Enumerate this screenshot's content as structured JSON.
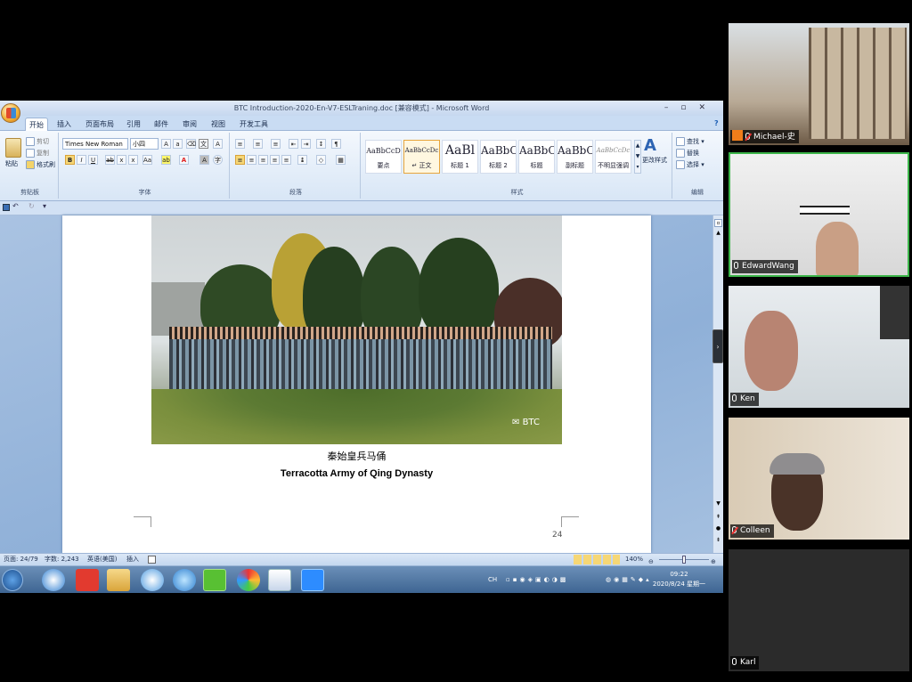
{
  "window": {
    "title": "BTC Introduction-2020-En-V7-ESLTraning.doc [兼容模式] - Microsoft Word",
    "controls": [
      "–",
      "▫",
      "✕"
    ]
  },
  "ribbon_tabs": [
    "开始",
    "插入",
    "页面布局",
    "引用",
    "邮件",
    "审阅",
    "视图",
    "开发工具"
  ],
  "active_tab": "开始",
  "clipboard": {
    "paste": "粘贴",
    "cut": "剪切",
    "copy": "复制",
    "format_painter": "格式刷",
    "label": "剪贴板"
  },
  "font": {
    "name": "Times New Roman",
    "size": "小四",
    "label": "字体"
  },
  "paragraph": {
    "label": "段落"
  },
  "styles": {
    "label": "样式",
    "items": [
      {
        "sample": "AaBbCcD",
        "name": "要点"
      },
      {
        "sample": "AaBbCcDc",
        "name": "↵ 正文"
      },
      {
        "sample": "AaBl",
        "name": "标题 1"
      },
      {
        "sample": "AaBbC",
        "name": "标题 2"
      },
      {
        "sample": "AaBbC",
        "name": "标题"
      },
      {
        "sample": "AaBbC",
        "name": "副标题"
      },
      {
        "sample": "AaBbCcDc",
        "name": "不明显强调"
      }
    ],
    "change_styles": "更改样式"
  },
  "editing": {
    "find": "查找 ▾",
    "replace": "替换",
    "select": "选择 ▾",
    "label": "编辑"
  },
  "document": {
    "watermark": "BTC",
    "caption_cn": "秦始皇兵马俑",
    "caption_en": "Terracotta Army of Qing Dynasty",
    "page_number": "24"
  },
  "statusbar": {
    "page": "页面: 24/79",
    "words": "字数: 2,243",
    "language": "英语(美国)",
    "insert": "插入",
    "zoom": "140%"
  },
  "taskbar": {
    "clock_time": "09:22",
    "clock_date": "2020/8/24 星期一",
    "tray_lang": "CH"
  },
  "participants": [
    {
      "name": "Michael-史",
      "muted": true
    },
    {
      "name": "EdwardWang",
      "muted": false
    },
    {
      "name": "Ken",
      "muted": false
    },
    {
      "name": "Colleen",
      "muted": true
    },
    {
      "name": "Karl",
      "muted": false
    }
  ]
}
